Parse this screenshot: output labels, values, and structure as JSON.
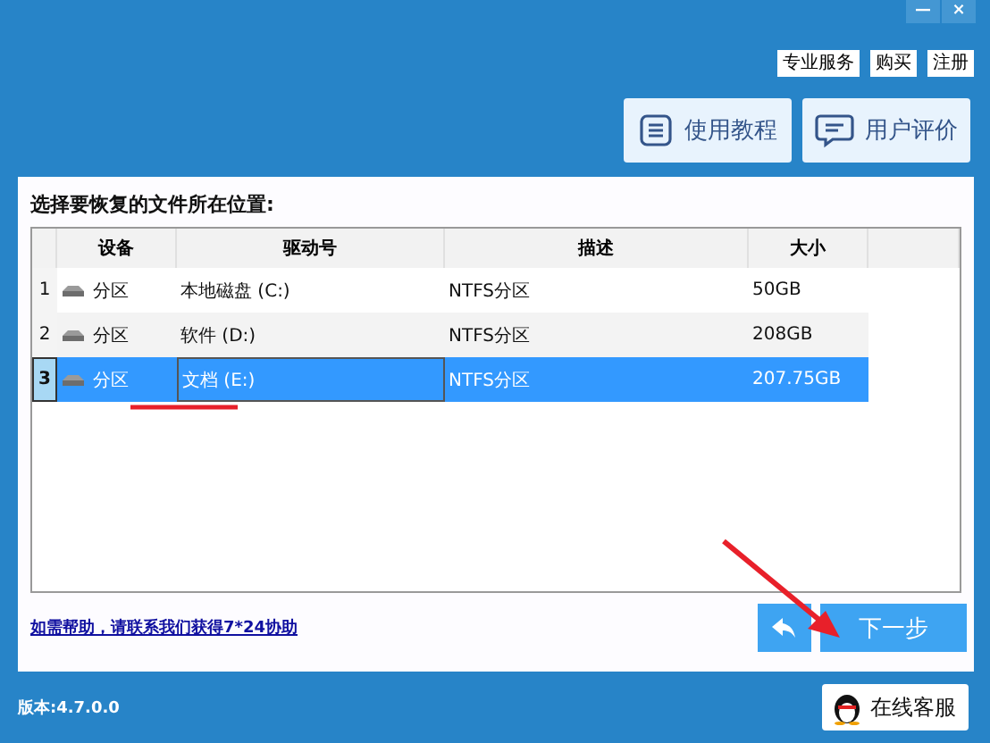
{
  "window_controls": [
    "—",
    "×"
  ],
  "top_links": [
    "专业服务",
    "购买",
    "注册"
  ],
  "header_buttons": [
    {
      "label": "使用教程",
      "kind": "tutorial"
    },
    {
      "label": "用户评价",
      "kind": "review"
    }
  ],
  "panel_title": "选择要恢复的文件所在位置:",
  "table": {
    "columns": [
      "设备",
      "驱动号",
      "描述",
      "大小"
    ],
    "rows": [
      {
        "index": "1",
        "device": "分区",
        "drive": "本地磁盘 (C:)",
        "description": "NTFS分区",
        "size": "50GB",
        "selected": false
      },
      {
        "index": "2",
        "device": "分区",
        "drive": "软件 (D:)",
        "description": "NTFS分区",
        "size": "208GB",
        "selected": false
      },
      {
        "index": "3",
        "device": "分区",
        "drive": "文档 (E:)",
        "description": "NTFS分区",
        "size": "207.75GB",
        "selected": true
      }
    ]
  },
  "help_link": "如需帮助，请联系我们获得7*24协助",
  "next_button": "下一步",
  "version": "版本:4.7.0.0",
  "support_button": "在线客服"
}
